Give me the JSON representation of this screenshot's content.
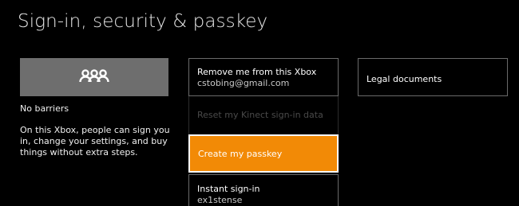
{
  "page": {
    "title": "Sign-in, security & passkey"
  },
  "profile": {
    "icon": "people-group-icon",
    "heading": "No barriers",
    "description": "On this Xbox, people can sign you in, change your settings, and buy things without extra steps."
  },
  "menu": {
    "remove": {
      "label": "Remove me from this Xbox",
      "sub": "cstobing@gmail.com"
    },
    "reset": {
      "label": "Reset my Kinect sign-in data",
      "state": "disabled"
    },
    "create": {
      "label": "Create my passkey",
      "state": "focused"
    },
    "instant": {
      "label": "Instant sign-in",
      "sub": "ex1stense"
    }
  },
  "legal": {
    "label": "Legal documents"
  },
  "colors": {
    "background": "#000000",
    "accent": "#f28a06",
    "tile": "#6e6e6e",
    "disabled_text": "#4a4a4a"
  }
}
